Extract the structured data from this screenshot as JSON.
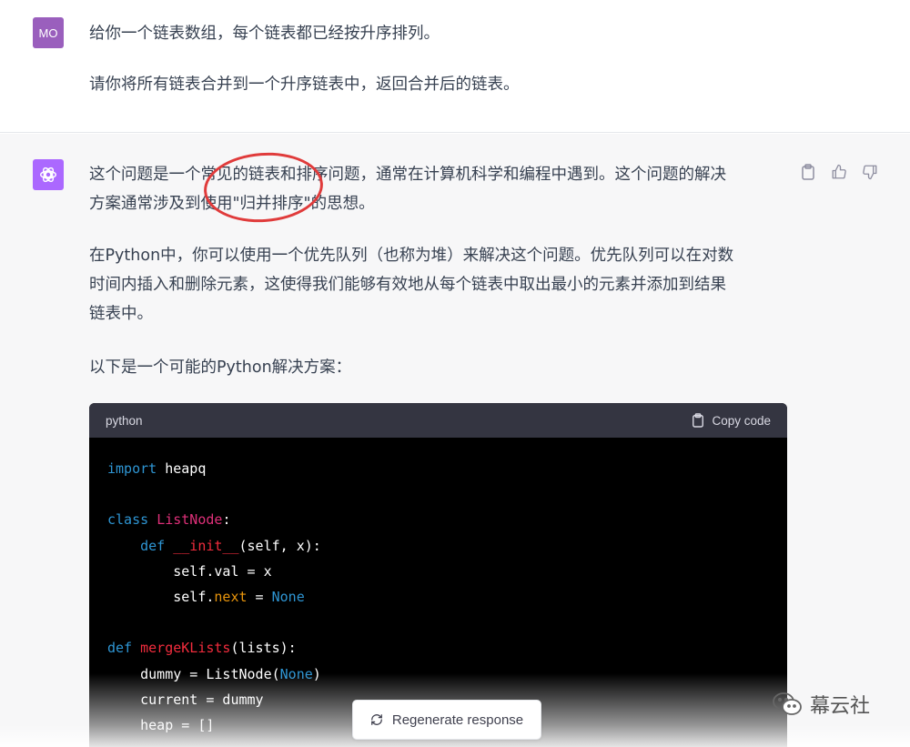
{
  "user": {
    "avatar_initials": "MO",
    "lines": [
      "给你一个链表数组，每个链表都已经按升序排列。",
      "请你将所有链表合并到一个升序链表中，返回合并后的链表。"
    ]
  },
  "assistant": {
    "icon": "openai-logo-icon",
    "paragraphs": [
      {
        "lines": [
          "这个问题是一个常见的链表和排序问题，通常在计算机科学和编程中遇到。这个问题的解决",
          "方案通常涉及到使用\"归并排序\"的思想。"
        ]
      },
      {
        "lines": [
          "在Python中，你可以使用一个优先队列（也称为堆）来解决这个问题。优先队列可以在对数",
          "时间内插入和删除元素，这使得我们能够有效地从每个链表中取出最小的元素并添加到结果",
          "链表中。"
        ]
      },
      {
        "lines": [
          "以下是一个可能的Python解决方案："
        ]
      }
    ],
    "actions": [
      "clipboard-icon",
      "thumbs-up-icon",
      "thumbs-down-icon"
    ]
  },
  "code": {
    "language": "python",
    "copy_label": "Copy code"
  },
  "regenerate_label": "Regenerate response",
  "watermark_text": "幕云社",
  "colors": {
    "user_avatar": "#9a5fbd",
    "bot_avatar": "#ab68ff",
    "annotation": "#e03b3b",
    "code_bg": "#000000",
    "code_header": "#343541"
  }
}
